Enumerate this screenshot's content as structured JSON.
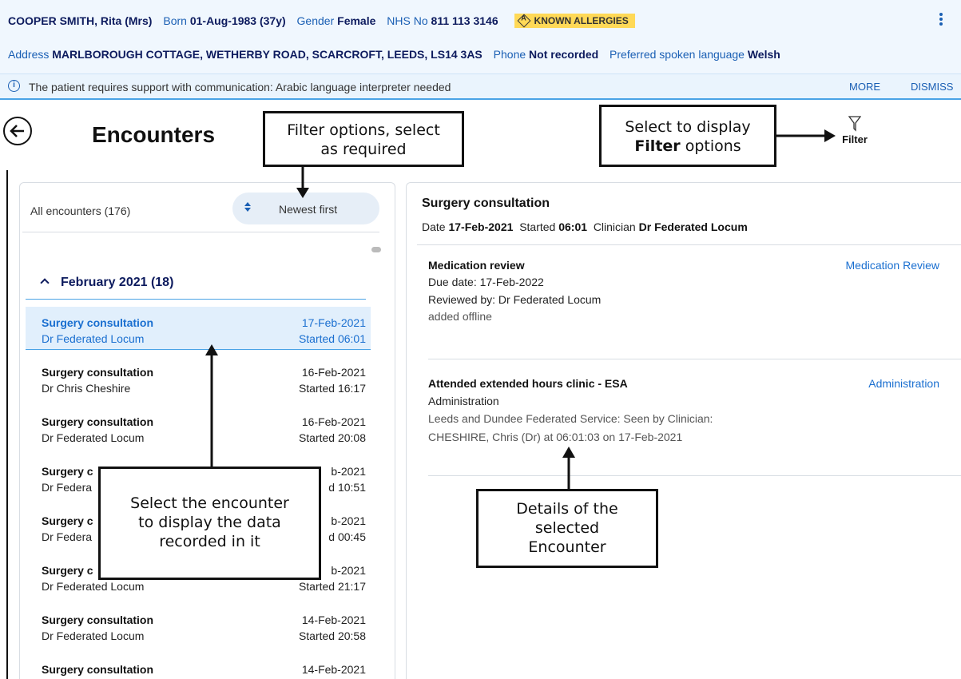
{
  "patient": {
    "name": "COOPER SMITH, Rita (Mrs)",
    "born_label": "Born",
    "born_value": "01-Aug-1983 (37y)",
    "gender_label": "Gender",
    "gender_value": "Female",
    "nhs_label": "NHS No",
    "nhs_value": "811 113 3146",
    "allergy_badge": "KNOWN ALLERGIES",
    "allergy_icon_letter": "A",
    "address_label": "Address",
    "address_value": "MARLBOROUGH COTTAGE, WETHERBY ROAD, SCARCROFT, LEEDS, LS14 3AS",
    "phone_label": "Phone",
    "phone_value": "Not recorded",
    "language_label": "Preferred spoken language",
    "language_value": "Welsh"
  },
  "alert": {
    "icon": "info-icon",
    "icon_glyph": "i",
    "text": "The patient requires support with communication: Arabic language interpreter needed",
    "more_label": "MORE",
    "dismiss_label": "DISMISS"
  },
  "page": {
    "title": "Encounters",
    "filter_label": "Filter"
  },
  "list": {
    "count_label": "All encounters (176)",
    "sort_label": "Newest first",
    "month_header": "February 2021 (18)",
    "encounters": [
      {
        "title": "Surgery consultation",
        "clinician": "Dr Federated Locum",
        "date": "17-Feb-2021",
        "started": "Started 06:01",
        "selected": true
      },
      {
        "title": "Surgery consultation",
        "clinician": "Dr Chris Cheshire",
        "date": "16-Feb-2021",
        "started": "Started 16:17"
      },
      {
        "title": "Surgery consultation",
        "clinician": "Dr Federated Locum",
        "date": "16-Feb-2021",
        "started": "Started 20:08"
      },
      {
        "title": "Surgery c",
        "clinician": "Dr Federa",
        "date": "b-2021",
        "started": "d 10:51"
      },
      {
        "title": "Surgery c",
        "clinician": "Dr Federa",
        "date": "b-2021",
        "started": "d 00:45"
      },
      {
        "title": "Surgery c",
        "clinician": "Dr Federated Locum",
        "date": "b-2021",
        "started": "Started 21:17"
      },
      {
        "title": "Surgery consultation",
        "clinician": "Dr Federated Locum",
        "date": "14-Feb-2021",
        "started": "Started 20:58"
      },
      {
        "title": "Surgery consultation",
        "clinician": "",
        "date": "14-Feb-2021",
        "started": ""
      }
    ]
  },
  "detail": {
    "title": "Surgery consultation",
    "date_label": "Date",
    "date_value": "17-Feb-2021",
    "started_label": "Started",
    "started_value": "06:01",
    "clinician_label": "Clinician",
    "clinician_value": "Dr Federated Locum",
    "items": [
      {
        "title": "Medication review",
        "category": "Medication Review",
        "line1": "Due date: 17-Feb-2022",
        "line2": "Reviewed by: Dr Federated Locum",
        "line3": "added offline"
      },
      {
        "title": "Attended extended hours clinic - ESA",
        "category": "Administration",
        "line1": "Administration",
        "line2": "Leeds and Dundee Federated Service: Seen by Clinician:",
        "line3": "CHESHIRE, Chris (Dr) at 06:01:03 on 17-Feb-2021"
      }
    ]
  },
  "callouts": {
    "filter_options_l1": "Filter options, select",
    "filter_options_l2": "as required",
    "select_display_l1": "Select to display",
    "select_display_bold": "Filter",
    "select_display_rest": " options",
    "select_enc_l1": "Select the encounter",
    "select_enc_l2": "to display the data",
    "select_enc_l3": "recorded in it",
    "details_l1": "Details of the",
    "details_l2": "selected",
    "details_l3": "Encounter"
  },
  "colors": {
    "accent": "#1a5fb4",
    "selected_text": "#1a6fd0",
    "banner_bg": "#f0f7fe",
    "allergy_badge": "#ffd957"
  }
}
